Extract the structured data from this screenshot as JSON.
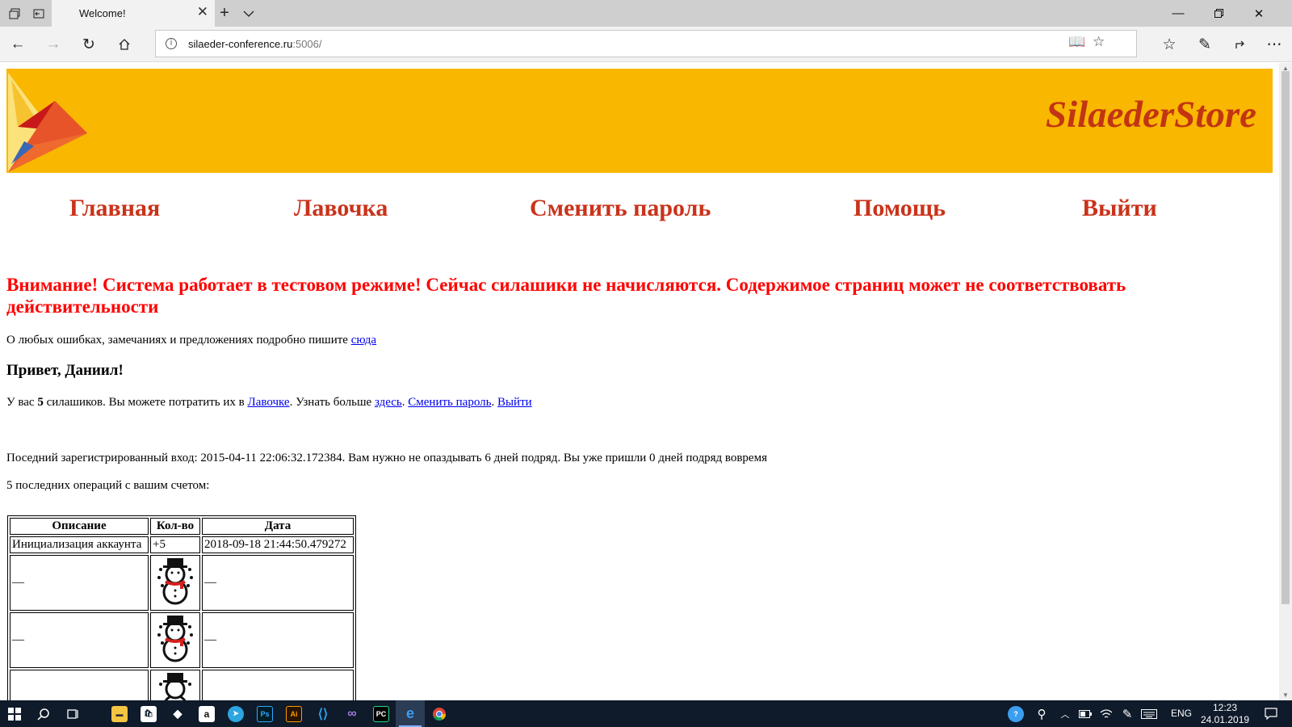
{
  "browser": {
    "tab_title": "Welcome!",
    "address_host": "silaeder-conference.ru",
    "address_port": ":5006/"
  },
  "site": {
    "brand": "SilaederStore",
    "menu": [
      "Главная",
      "Лавочка",
      "Сменить пароль",
      "Помощь",
      "Выйти"
    ],
    "warning": "Внимание! Система работает в тестовом режиме! Сейчас силашики не начисляются. Содержимое страниц может не соответствовать действительности",
    "feedback_text": "О любых ошибках, замечаниях и предложениях подробно пишите",
    "feedback_link": "сюда",
    "greeting": "Привет, Даниил!",
    "balance": {
      "prefix": "У вас",
      "amount": "5",
      "middle": "силашиков. Вы можете потратить их в",
      "shop_link": "Лавочке",
      "learn_text": ". Узнать больше",
      "here_link": "здесь",
      "change_password_link": "Сменить пароль",
      "logout_link": "Выйти"
    },
    "last_login": "Поседний зарегистрированный вход: 2015-04-11 22:06:32.172384. Вам нужно не опаздывать 6 дней подряд. Вы уже пришли 0 дней подряд вовремя",
    "ops_caption": "5 последних операций с вашим счетом:",
    "ops_table": {
      "headers": [
        "Описание",
        "Кол-во",
        "Дата"
      ],
      "rows": [
        {
          "desc": "Инициализация аккаунта",
          "qty": "+5",
          "date": "2018-09-18 21:44:50.479272"
        },
        {
          "desc": "—",
          "qty_icon": "snowman-icon",
          "date": "—"
        },
        {
          "desc": "—",
          "qty_icon": "snowman-icon",
          "date": "—"
        },
        {
          "desc": "",
          "qty_icon": "snowman-icon",
          "date": ""
        }
      ]
    }
  },
  "taskbar": {
    "lang": "ENG",
    "time": "12:23",
    "date": "24.01.2019"
  },
  "colors": {
    "banner": "#f9b700",
    "brand": "#c23512",
    "menu": "#c9331a",
    "warning": "#ff0000",
    "link": "#0000ee"
  }
}
